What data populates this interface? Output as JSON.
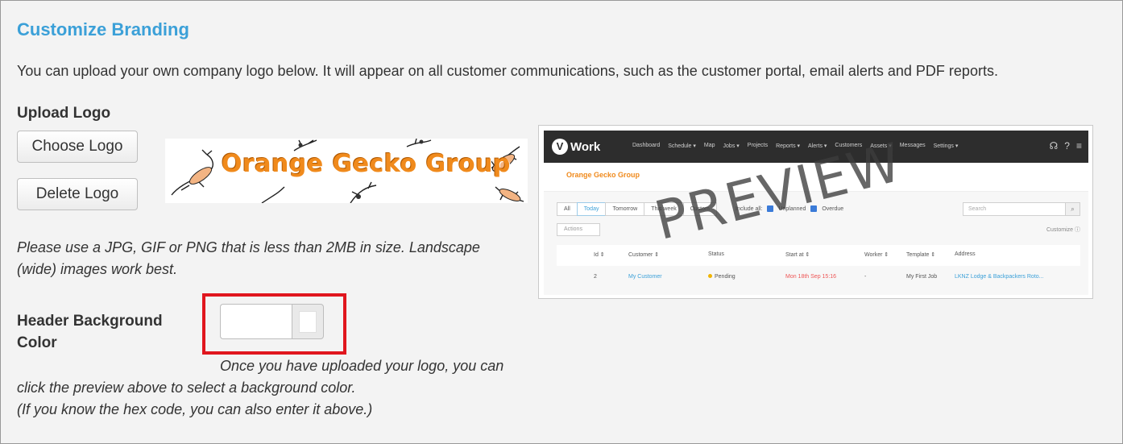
{
  "section": {
    "title": "Customize Branding",
    "intro": "You can upload your own company logo below. It will appear on all customer communications, such as the customer portal, email alerts and PDF reports."
  },
  "upload": {
    "label": "Upload Logo",
    "choose_button": "Choose Logo",
    "delete_button": "Delete Logo",
    "logo_text": "Orange Gecko Group",
    "note_line1": "Please use a JPG, GIF or PNG that is less than 2MB in size. Landscape",
    "note_line2": "(wide) images work best."
  },
  "header_color": {
    "label_line1": "Header Background",
    "label_line2": "Color",
    "value": "",
    "swatch_color": "#ffffff",
    "hint_line1": "Once you have uploaded your logo, you can",
    "hint_line2": "click the preview above to select a background color.",
    "hint_line3": "(If you know the hex code, you can also enter it above.)"
  },
  "preview": {
    "watermark": "PREVIEW",
    "brand_letter": "V",
    "brand_name": "Work",
    "nav": [
      "Dashboard",
      "Schedule ▾",
      "Map",
      "Jobs ▾",
      "Projects",
      "Reports ▾",
      "Alerts ▾",
      "Customers",
      "Assets ▾",
      "Messages",
      "Settings ▾"
    ],
    "logo_text": "Orange Gecko Group",
    "tabs": [
      "All",
      "Today",
      "Tomorrow",
      "This week",
      "Custom"
    ],
    "include_label": "Include all:",
    "include_opt1": "Unplanned",
    "include_opt2": "Overdue",
    "search_placeholder": "Search",
    "actions_label": "Actions",
    "customize_label": "Customize ⓘ",
    "columns": [
      "Id ⇕",
      "Customer ⇕",
      "Status",
      "Start at ⇕",
      "Worker ⇕",
      "Template ⇕",
      "Address"
    ],
    "row": {
      "id": "2",
      "customer": "My Customer",
      "status": "Pending",
      "start": "Mon 18th Sep 15:16",
      "worker": "-",
      "template": "My First Job",
      "address": "LKNZ Lodge & Backpackers Roto..."
    }
  },
  "colors": {
    "accent": "#3ba0d8",
    "highlight": "#e0161e",
    "logo_orange": "#f08a1c"
  }
}
